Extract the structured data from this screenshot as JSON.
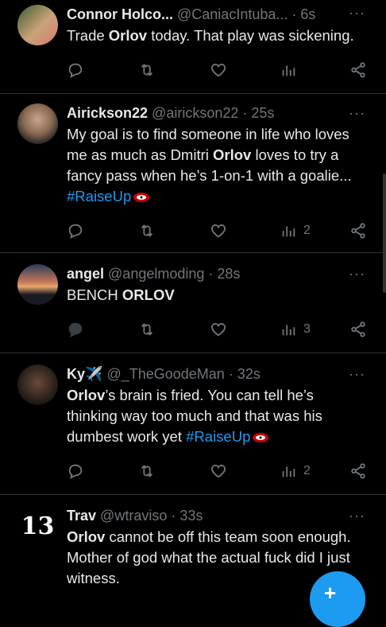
{
  "tweets": [
    {
      "name": "Connor Holco...",
      "handle": "@CaniacIntuba...",
      "time": "· 6s",
      "text_parts": [
        "Trade ",
        "Orlov",
        " today. That play was sickening."
      ],
      "views": ""
    },
    {
      "name": "Airickson22",
      "handle": "@airickson22",
      "time": "· 25s",
      "text_parts": [
        "My goal is to find someone in life who loves me as much as Dmitri ",
        "Orlov",
        " loves to try a fancy pass when he’s 1-on-1 with a goalie..."
      ],
      "hashtag": "#RaiseUp",
      "views": "2"
    },
    {
      "name": "angel",
      "handle": "@angelmoding",
      "time": "· 28s",
      "text_parts": [
        "BENCH ",
        "ORLOV",
        ""
      ],
      "views": "3"
    },
    {
      "name": "Ky✈️",
      "handle": "@_TheGoodeMan",
      "time": "· 32s",
      "text_parts": [
        "",
        "Orlov",
        "’s brain is fried. You can tell he’s thinking way too much and that was his dumbest work yet "
      ],
      "hashtag": "#RaiseUp",
      "views": "2"
    },
    {
      "name": "Trav",
      "handle": "@wtraviso",
      "time": "· 33s",
      "avatar_text": "13",
      "text_parts": [
        "",
        "Orlov",
        " cannot be off this team soon enough. Mother of god what the actual fuck did I just witness."
      ]
    }
  ],
  "more_label": "···",
  "fab_label": "+"
}
